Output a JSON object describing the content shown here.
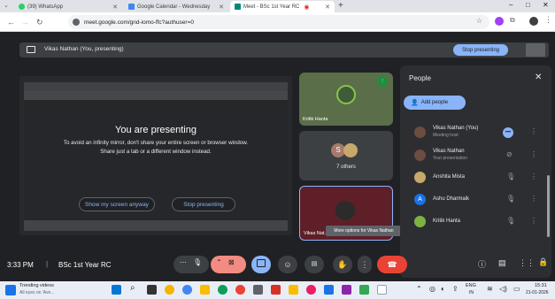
{
  "browser": {
    "tabs": [
      {
        "label": "(39) WhatsApp",
        "color": "#25d366"
      },
      {
        "label": "Google Calendar - Wednesday",
        "color": "#4285f4"
      },
      {
        "label": "Meet - BSc 1st Year RC",
        "color": "#00897b"
      }
    ],
    "new_tab": "+",
    "window_controls": [
      "–",
      "□",
      "✕"
    ],
    "url": "meet.google.com/gnd-iomo-ffc?authuser=0"
  },
  "meet": {
    "banner_text": "Vikas Nathan (You, presenting)",
    "stop_presenting_label": "Stop presenting",
    "presenting": {
      "title": "You are presenting",
      "message_line1": "To avoid an infinity mirror, don't share your entire screen or browser window.",
      "message_line2": "Share just a tab or a different window instead.",
      "show_screen_label": "Show my screen anyway",
      "stop_label": "Stop presenting"
    },
    "tiles": {
      "kritik_name": "Kritik Hanta",
      "others_label": "7 others",
      "others_initial": "S",
      "self_name": "Vikas Nat...",
      "tooltip": "More options for Vikas Nathan"
    },
    "people_panel": {
      "title": "People",
      "add_people_label": "Add people",
      "members": [
        {
          "name": "Vikas Nathan (You)",
          "sub": "Meeting host",
          "avatar_color": "#6d4c41"
        },
        {
          "name": "Vikas Nathan",
          "sub": "Your presentation",
          "avatar_color": "#6d4c41"
        },
        {
          "name": "Anshita Mista",
          "sub": "",
          "avatar_color": "#c8a86b"
        },
        {
          "name": "Ashu Dharmaik",
          "sub": "",
          "avatar_color": "#1a73e8",
          "initial": "A"
        },
        {
          "name": "Kritik Hanta",
          "sub": "",
          "avatar_color": "#7cb342"
        }
      ]
    },
    "bottom": {
      "time": "3:33 PM",
      "separator": "|",
      "meeting_name": "BSc 1st Year RC"
    }
  },
  "taskbar": {
    "news_title": "Trending videos",
    "news_sub": "All eyes on 'Ave...",
    "lang": "ENG",
    "lang_sub": "IN",
    "clock_time": "15:31",
    "clock_date": "21-01-2026"
  }
}
